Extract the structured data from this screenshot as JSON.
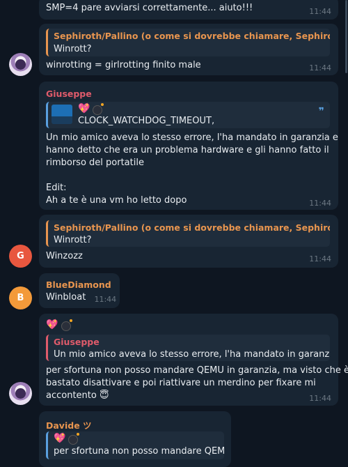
{
  "messages": {
    "m0": {
      "text_line": "SMP=4 pare avviarsi correttamente... aiuto!!!",
      "time": "11:44"
    },
    "m1": {
      "quote_name": "Sephiroth/Pallino (o come si dovrebbe chiamare, Sephiroth + …",
      "quote_text": "Winrott?",
      "text": "winrotting = girlrotting finito male",
      "time": "11:44"
    },
    "m2": {
      "sender": "Giuseppe",
      "quote_emoji": "💖",
      "quote_text": "CLOCK_WATCHDOG_TIMEOUT,",
      "quote_mark": "❞",
      "lines": [
        "Un mio amico aveva lo stesso errore, l'ha mandato in garanzia e",
        "hanno detto che era un problema hardware e gli hanno fatto il",
        "rimborso del portatile",
        "",
        "Edit:",
        "Ah a te è una vm ho letto dopo"
      ],
      "time": "11:44"
    },
    "m3": {
      "avatar_letter": "G",
      "quote_name": "Sephiroth/Pallino (o come si dovrebbe chiamare, Sephiroth + …",
      "quote_text": "Winrott?",
      "text": "Winzozz",
      "time": "11:44"
    },
    "m4": {
      "avatar_letter": "B",
      "sender": "BlueDiamond",
      "text": "Winbloat",
      "time": "11:44"
    },
    "m5": {
      "emoji": "💖",
      "quote_name": "Giuseppe",
      "quote_text": "Un mio amico aveva lo stesso errore, l'ha mandato in garanzia e …",
      "lines": [
        "per sfortuna non posso mandare QEMU in garanzia, ma visto che è",
        "bastato disattivare e poi riattivare un merdino per fixare mi",
        "accontento 😇"
      ],
      "time": "11:44"
    },
    "m6": {
      "sender": "Davide ツ",
      "quote_emoji": "💖",
      "quote_text": "per sfortuna non posso mandare QEM…"
    }
  },
  "colors": {
    "background": "#0e1621",
    "bubble": "#182533",
    "quote_orange": "#e8954f",
    "quote_red": "#e05b6b",
    "giuseppe_name": "#e05b6b",
    "bluediamond_name": "#e8954f",
    "davide_name": "#e8954f",
    "avatar_g": "#e8573f",
    "avatar_b": "#f39a3a"
  }
}
